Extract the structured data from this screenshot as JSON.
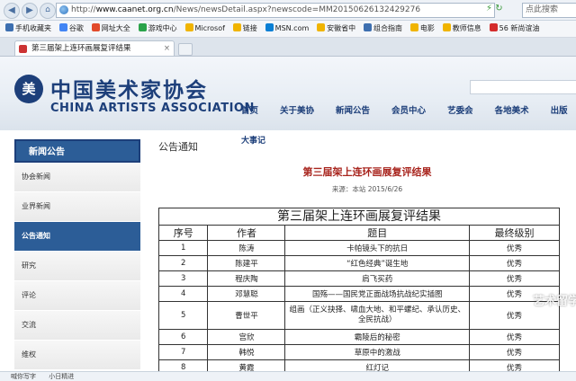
{
  "browser": {
    "url_host": "www.caanet.org.cn",
    "url_path": "/News/newsDetail.aspx?newscode=MM20150626132429276",
    "url_prefix": "http://",
    "search_placeholder": "点此搜索",
    "bookmarks": [
      "手机收藏夹",
      "谷歌",
      "网址大全",
      "游戏中心",
      "Microsof",
      "链接",
      "MSN.com",
      "安徽省中",
      "组合指南",
      "电影",
      "教师信息",
      "56 新尚谊油"
    ],
    "tab_title": "第三届架上连环画展复评结果"
  },
  "site": {
    "logo_cn": "中国美术家协会",
    "logo_en": "CHINA ARTISTS ASSOCIATION",
    "nav": [
      "首页",
      "关于美协",
      "新闻公告",
      "会员中心",
      "艺委会",
      "各地美术",
      "出版"
    ],
    "nav_second": "大事记"
  },
  "sidebar": {
    "header": "新闻公告",
    "items": [
      "协会新闻",
      "业界新闻",
      "公告通知",
      "研究",
      "评论",
      "交流",
      "维权"
    ],
    "active_index": 2
  },
  "content": {
    "breadcrumb": "公告通知",
    "title": "第三届架上连环画展复评结果",
    "source": "来源：本站  2015/6/26",
    "table_caption": "第三届架上连环画展复评结果",
    "columns": [
      "序号",
      "作者",
      "题目",
      "最终级别"
    ],
    "rows": [
      [
        "1",
        "陈涛",
        "卡帕镜头下的抗日",
        "优秀"
      ],
      [
        "2",
        "陈建平",
        "“红色经典”诞生地",
        "优秀"
      ],
      [
        "3",
        "程庆陶",
        "肩飞买药",
        "优秀"
      ],
      [
        "4",
        "邓慧聪",
        "国殇——国民党正面战场抗战纪实插图",
        "优秀"
      ],
      [
        "5",
        "曹世平",
        "组画（正义抉择、啸血大地、和平螺纪、承认历史、全民抗战）",
        "优秀"
      ],
      [
        "6",
        "宫欣",
        "霸陵后的秘密",
        "优秀"
      ],
      [
        "7",
        "韩悦",
        "草原中的激战",
        "优秀"
      ],
      [
        "8",
        "黄霞",
        "红灯记",
        "优秀"
      ]
    ]
  },
  "watermark": "艺术留学",
  "status": [
    "喊你写字",
    "小日精进"
  ]
}
